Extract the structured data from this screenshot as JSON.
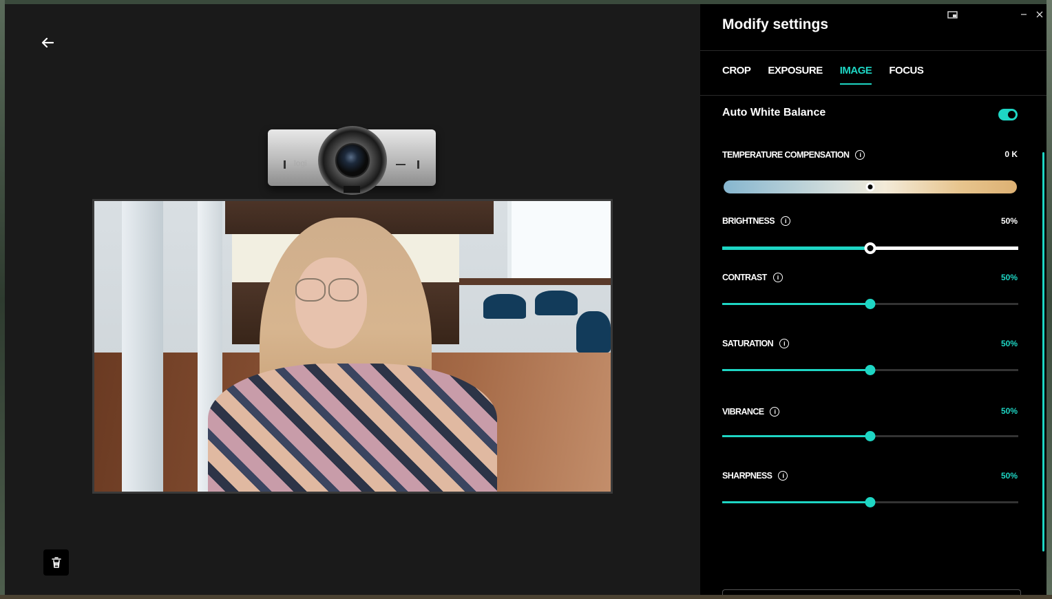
{
  "window": {
    "title": "Modify settings"
  },
  "tabs": [
    {
      "label": "CROP"
    },
    {
      "label": "EXPOSURE"
    },
    {
      "label": "IMAGE"
    },
    {
      "label": "FOCUS"
    }
  ],
  "active_tab": "IMAGE",
  "auto_white_balance": {
    "label": "Auto White Balance",
    "enabled": true
  },
  "settings": {
    "temperature": {
      "label": "TEMPERATURE COMPENSATION",
      "value": "0 K",
      "position": 0.5
    },
    "brightness": {
      "label": "BRIGHTNESS",
      "value": "50%",
      "level": 0.5
    },
    "contrast": {
      "label": "CONTRAST",
      "value": "50%",
      "level": 0.5
    },
    "saturation": {
      "label": "SATURATION",
      "value": "50%",
      "level": 0.5
    },
    "vibrance": {
      "label": "VIBRANCE",
      "value": "50%",
      "level": 0.5
    },
    "sharpness": {
      "label": "SHARPNESS",
      "value": "50%",
      "level": 0.5
    }
  },
  "webcam": {
    "brand_logo": "logi"
  },
  "icons": {
    "back": "arrow-left-icon",
    "info": "info-icon",
    "trash": "trash-icon",
    "miniplayer": "miniplayer-icon",
    "minimize": "minimize-icon",
    "close": "close-icon"
  },
  "colors": {
    "accent": "#1ed6c4",
    "panel_bg": "#000000",
    "preview_bg": "#1a1a1a"
  }
}
